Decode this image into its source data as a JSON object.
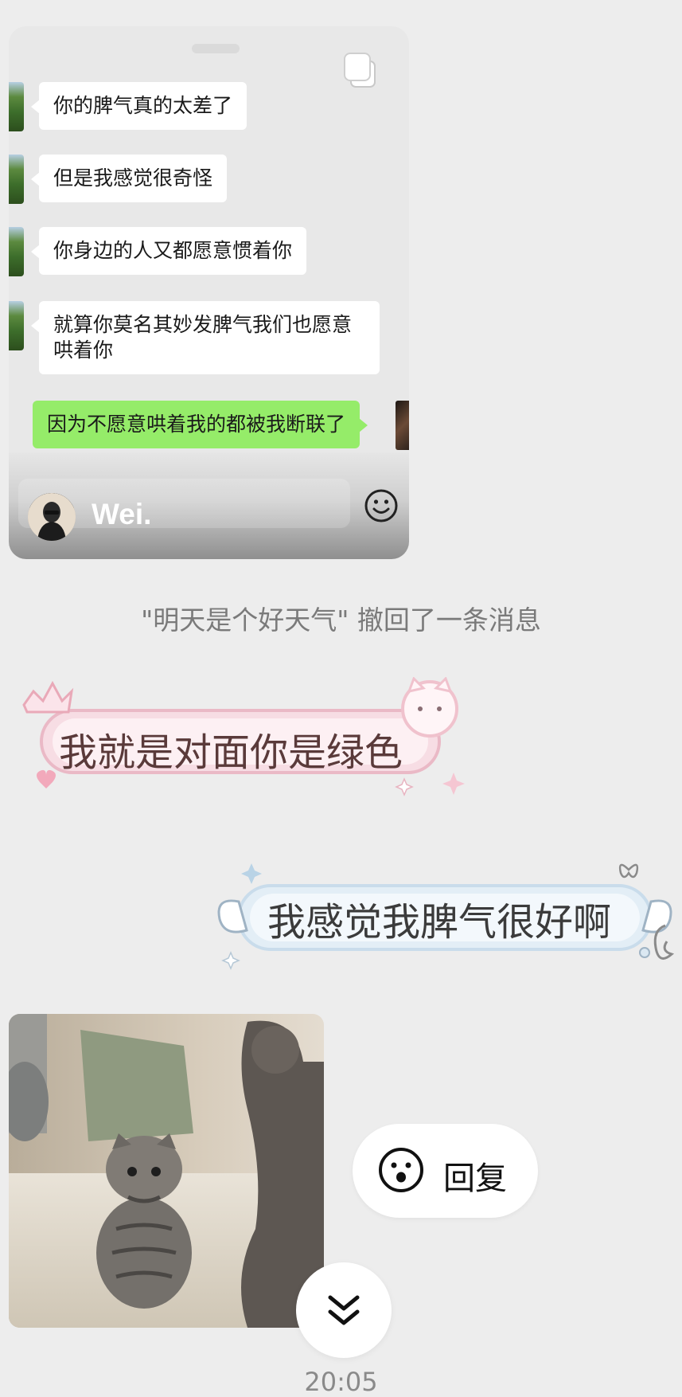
{
  "forwarded_card": {
    "messages": [
      {
        "text": "你的脾气真的太差了"
      },
      {
        "text": "但是我感觉很奇怪"
      },
      {
        "text": "你身边的人又都愿意惯着你"
      },
      {
        "text": "就算你莫名其妙发脾气我们也愿意哄着你"
      }
    ],
    "self_message": "因为不愿意哄着我的都被我断联了",
    "owner_name": "Wei.",
    "icons": [
      "copy-icon",
      "emoji-icon"
    ]
  },
  "system_notice": "\"明天是个好天气\" 撤回了一条消息",
  "sticker_messages": {
    "incoming": "我就是对面你是绿色",
    "outgoing": "我感觉我脾气很好啊"
  },
  "image_message": {
    "subject": "cat-gif"
  },
  "reply_button": {
    "label": "回复",
    "icon": "face-icon"
  },
  "scroll_button": {
    "icon": "double-chevron-down-icon"
  },
  "timestamp": "20:05",
  "colors": {
    "background": "#ededed",
    "self_bubble": "#95ec69",
    "peer_bubble": "#ffffff",
    "notice_text": "#7a7a7a"
  }
}
